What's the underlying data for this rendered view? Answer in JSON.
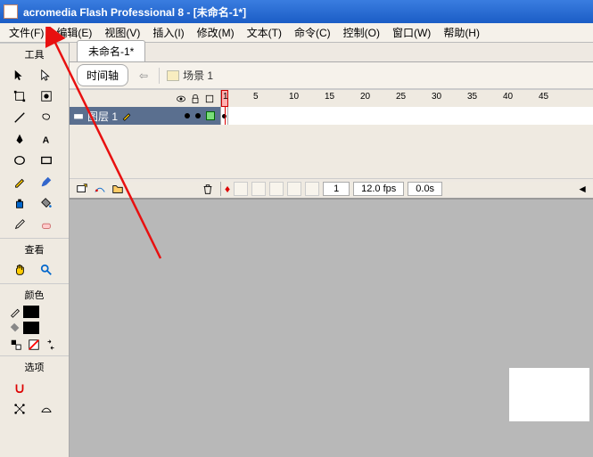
{
  "titlebar": {
    "text": "acromedia Flash Professional 8 - [未命名-1*]"
  },
  "menubar": {
    "items": [
      "文件(F)",
      "编辑(E)",
      "视图(V)",
      "插入(I)",
      "修改(M)",
      "文本(T)",
      "命令(C)",
      "控制(O)",
      "窗口(W)",
      "帮助(H)"
    ]
  },
  "toolbox": {
    "title_tools": "工具",
    "title_view": "查看",
    "title_color": "颜色",
    "title_options": "选项",
    "stroke_color": "#000000",
    "fill_color": "#000000"
  },
  "document": {
    "tab_name": "未命名-1*",
    "timeline_btn": "时间轴",
    "scene_label": "场景 1"
  },
  "timeline": {
    "ruler_ticks": [
      "1",
      "5",
      "10",
      "15",
      "20",
      "25",
      "30",
      "35",
      "40",
      "45"
    ],
    "layer_name": "图层 1",
    "current_frame": "1",
    "fps": "12.0 fps",
    "time": "0.0s"
  }
}
